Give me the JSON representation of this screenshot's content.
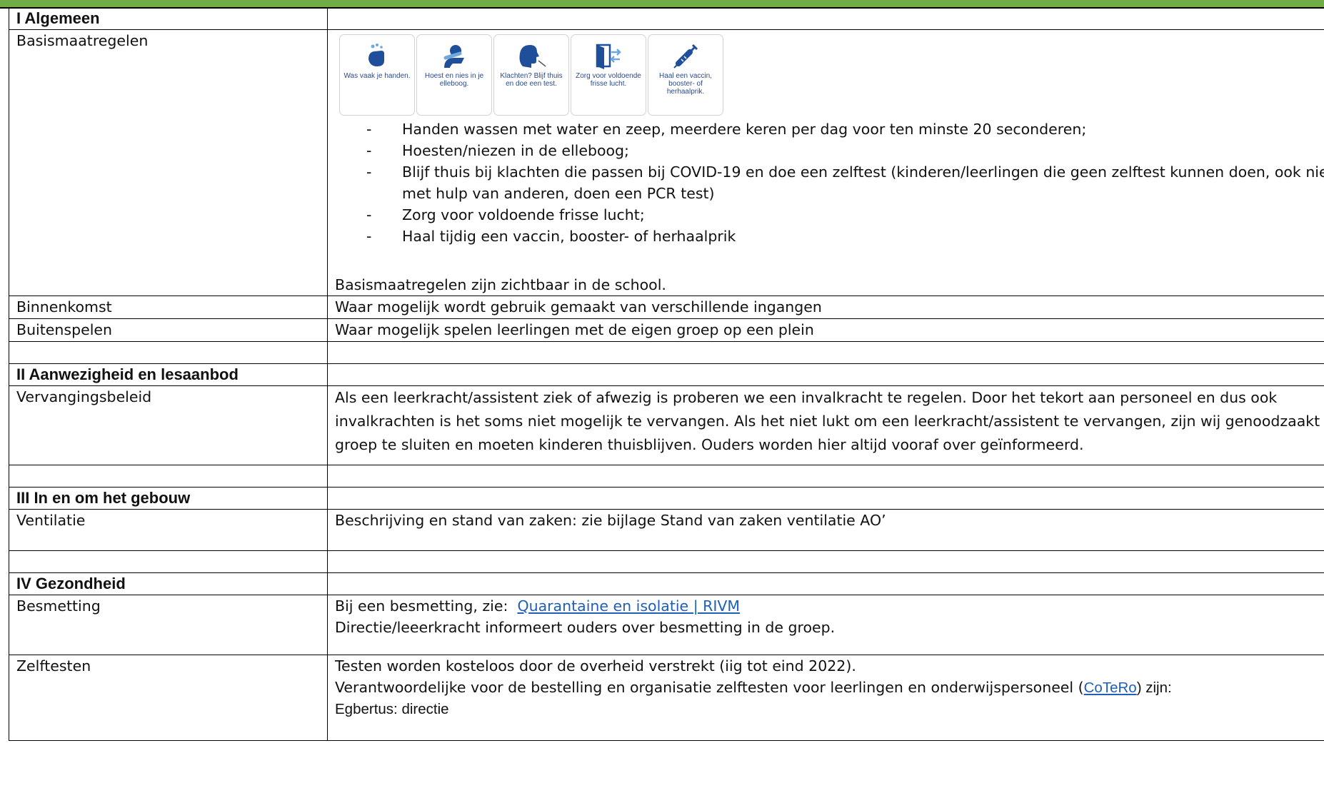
{
  "sections": [
    {
      "title": "I Algemeen",
      "rows": [
        {
          "label": "Basismaatregelen",
          "icons": [
            {
              "icon": "hand-washing-icon",
              "caption": "Was vaak je handen."
            },
            {
              "icon": "cough-elbow-icon",
              "caption": "Hoest en nies in je elleboog."
            },
            {
              "icon": "stay-home-test-icon",
              "caption": "Klachten? Blijf thuis en doe een test."
            },
            {
              "icon": "fresh-air-icon",
              "caption": "Zorg voor voldoende frisse lucht."
            },
            {
              "icon": "vaccine-syringe-icon",
              "caption": "Haal een vaccin, booster- of herhaalprik."
            }
          ],
          "bullets": [
            "Handen wassen met water en zeep, meerdere keren per dag voor ten minste 20 seconderen;",
            "Hoesten/niezen in de elleboog;",
            "Blijf thuis bij klachten die passen bij COVID-19 en doe een zelftest (kinderen/leerlingen die geen zelftest kunnen doen, ook niet met hulp van anderen, doen een PCR test)",
            "Zorg voor voldoende frisse lucht;",
            "Haal tijdig een vaccin, booster- of herhaalprik"
          ],
          "note": "Basismaatregelen zijn zichtbaar in de school."
        },
        {
          "label": "Binnenkomst",
          "text": "Waar mogelijk wordt gebruik gemaakt van verschillende ingangen"
        },
        {
          "label": "Buitenspelen",
          "text": "Waar mogelijk spelen leerlingen met de eigen groep op een plein"
        }
      ]
    },
    {
      "title": "II Aanwezigheid en lesaanbod",
      "rows": [
        {
          "label": "Vervangingsbeleid",
          "text": "Als een leerkracht/assistent ziek of afwezig is proberen we een invalkracht te regelen. Door het tekort aan personeel en dus ook invalkrachten is het soms niet mogelijk te vervangen. Als het niet lukt om een leerkracht/assistent te vervangen, zijn wij genoodzaakt een groep te sluiten en moeten kinderen thuisblijven. Ouders worden hier altijd vooraf over geïnformeerd."
        }
      ]
    },
    {
      "title": "III In en om het gebouw",
      "rows": [
        {
          "label": "Ventilatie",
          "text": "Beschrijving en stand van zaken: zie bijlage Stand van zaken ventilatie AO’"
        }
      ]
    },
    {
      "title": "IV Gezondheid",
      "rows": [
        {
          "label": "Besmetting",
          "prefix": "Bij een besmetting, zie: ",
          "link": "Quarantaine en isolatie | RIVM",
          "line2": "Directie/leeerkracht informeert ouders over besmetting in de groep."
        },
        {
          "label": "Zelftesten",
          "line1": "Testen worden kosteloos door de overheid verstrekt (iig tot eind 2022).",
          "line2_prefix": "Verantwoordelijke voor de bestelling en organisatie zelftesten voor leerlingen en onderwijspersoneel (",
          "link": "CoTeRo",
          "line2_suffix": ") zijn:",
          "line3": "Egbertus: directie"
        }
      ]
    }
  ],
  "colors": {
    "header_bar": "#70ad47",
    "link": "#1f5fb8",
    "icon": "#1f4e9a"
  }
}
